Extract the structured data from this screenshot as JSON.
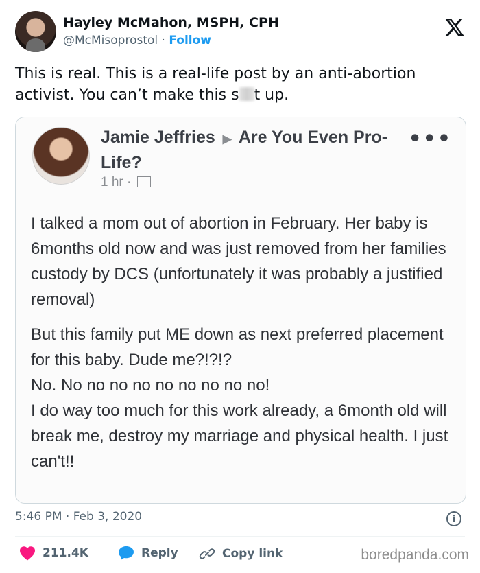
{
  "tweet": {
    "author_name": "Hayley McMahon, MSPH, CPH",
    "handle": "@McMisoprostol",
    "separator": "·",
    "follow_label": "Follow",
    "text_part1": "This is real. This is a real-life post by an anti-abortion activist. You can’t make this s",
    "text_part2": "t up.",
    "timestamp": "5:46 PM · Feb 3, 2020",
    "likes": "211.4K",
    "reply_label": "Reply",
    "copy_link_label": "Copy link"
  },
  "embedded_post": {
    "author": "Jamie Jeffries",
    "group": "Are You Even Pro-Life?",
    "time": "1 hr ·",
    "paragraph1": "I talked a mom out of abortion in February. Her baby is 6months old now and was just removed from her families custody by DCS (unfortunately it was probably a justified removal)",
    "paragraph2_lines": [
      "But this family put ME down as next preferred placement for this baby. Dude me?!?!?",
      "No. No no no no no no no no no!",
      "I do way too much for this work already, a 6month old will break me, destroy my marriage and physical health. I just can't!!"
    ]
  },
  "watermark": "boredpanda.com",
  "colors": {
    "link_blue": "#1d9bf0",
    "like_pink": "#f91880",
    "secondary_text": "#536471",
    "reply_blue": "#1d9bf0"
  },
  "icons": {
    "platform": "x-logo-icon",
    "like": "heart-icon",
    "reply": "speech-bubble-icon",
    "copy": "link-icon",
    "info": "info-icon",
    "more": "more-dots-icon"
  }
}
